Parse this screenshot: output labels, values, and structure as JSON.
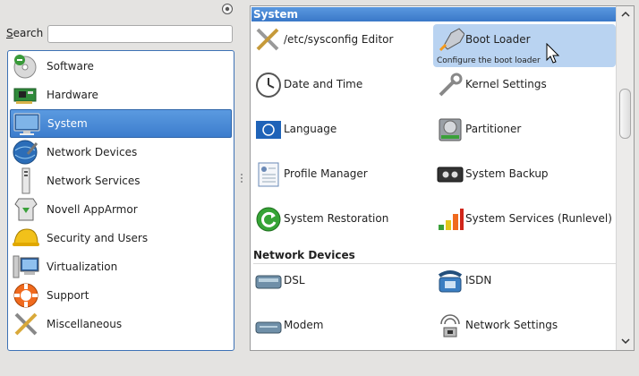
{
  "search": {
    "label_prefix": "S",
    "label_rest": "earch",
    "value": ""
  },
  "categories": [
    {
      "label": "Software",
      "icon": "software-icon",
      "selected": false
    },
    {
      "label": "Hardware",
      "icon": "hardware-icon",
      "selected": false
    },
    {
      "label": "System",
      "icon": "system-icon",
      "selected": true
    },
    {
      "label": "Network Devices",
      "icon": "network-devices-icon",
      "selected": false
    },
    {
      "label": "Network Services",
      "icon": "network-services-icon",
      "selected": false
    },
    {
      "label": "Novell AppArmor",
      "icon": "apparmor-icon",
      "selected": false
    },
    {
      "label": "Security and Users",
      "icon": "security-icon",
      "selected": false
    },
    {
      "label": "Virtualization",
      "icon": "virtualization-icon",
      "selected": false
    },
    {
      "label": "Support",
      "icon": "support-icon",
      "selected": false
    },
    {
      "label": "Miscellaneous",
      "icon": "miscellaneous-icon",
      "selected": false
    }
  ],
  "system_group": {
    "title": "System",
    "modules": [
      {
        "label": "/etc/sysconfig Editor",
        "icon": "sysconfig-editor-icon"
      },
      {
        "label": "Boot Loader",
        "icon": "boot-loader-icon",
        "description": "Configure the boot loader",
        "highlighted": true
      },
      {
        "label": "Date and Time",
        "icon": "clock-icon"
      },
      {
        "label": "Kernel Settings",
        "icon": "kernel-settings-icon"
      },
      {
        "label": "Language",
        "icon": "language-icon"
      },
      {
        "label": "Partitioner",
        "icon": "partitioner-icon"
      },
      {
        "label": "Profile Manager",
        "icon": "profile-manager-icon"
      },
      {
        "label": "System Backup",
        "icon": "system-backup-icon"
      },
      {
        "label": "System Restoration",
        "icon": "system-restoration-icon"
      },
      {
        "label": "System Services (Runlevel)",
        "icon": "system-services-icon"
      }
    ]
  },
  "network_group": {
    "title": "Network Devices",
    "modules": [
      {
        "label": "DSL",
        "icon": "dsl-icon"
      },
      {
        "label": "ISDN",
        "icon": "isdn-icon"
      },
      {
        "label": "Modem",
        "icon": "modem-icon"
      },
      {
        "label": "Network Settings",
        "icon": "network-settings-icon"
      }
    ]
  },
  "colors": {
    "selection": "#3c7dcd",
    "hover": "#b9d3f1",
    "border": "#3d72b5"
  }
}
